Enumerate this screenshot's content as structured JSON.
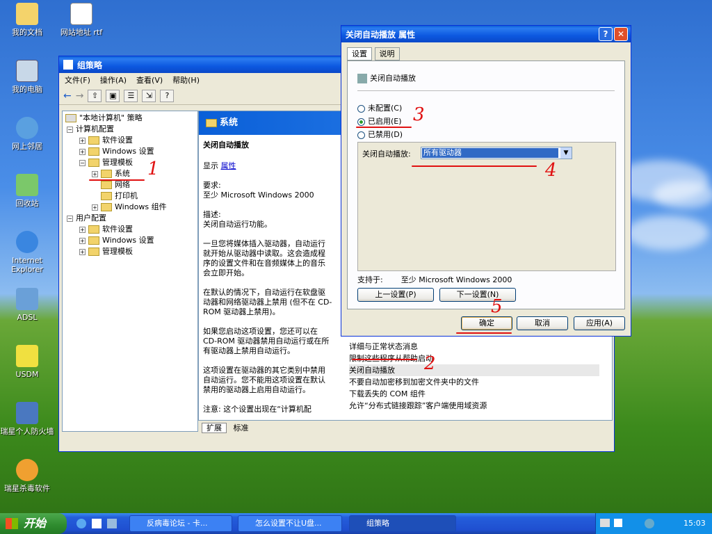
{
  "desktop": {
    "icons": [
      "我的文档",
      "网站地址 rtf",
      "我的电脑",
      "网上邻居",
      "回收站",
      "Internet Explorer",
      "ADSL",
      "USDM",
      "瑞星个人防火墙",
      "瑞星杀毒软件"
    ]
  },
  "gp": {
    "title": "组策略",
    "menus": [
      "文件(F)",
      "操作(A)",
      "查看(V)",
      "帮助(H)"
    ],
    "tree": [
      "\"本地计算机\" 策略",
      "计算机配置",
      "软件设置",
      "Windows 设置",
      "管理模板",
      "系统",
      "网络",
      "打印机",
      "Windows 组件",
      "用户配置",
      "软件设置",
      "Windows 设置",
      "管理模板"
    ],
    "header": "系统",
    "policy_title": "关闭自动播放",
    "show": "显示",
    "props_link": "属性",
    "req_label": "要求:",
    "req_value": "至少 Microsoft Windows 2000",
    "desc_label": "描述:",
    "desc_value": "关闭自动运行功能。",
    "para1": "一旦您将媒体插入驱动器，自动运行就开始从驱动器中读取。这会造成程序的设置文件和在音频媒体上的音乐会立即开始。",
    "para2": "在默认的情况下，自动运行在软盘驱动器和网络驱动器上禁用 (但不在 CD-ROM 驱动器上禁用)。",
    "para3": "如果您启动这项设置，您还可以在 CD-ROM 驱动器禁用自动运行或在所有驱动器上禁用自动运行。",
    "para4": "这项设置在驱动器的其它类别中禁用自动运行。您不能用这项设置在默认禁用的驱动器上启用自动运行。",
    "para5": "注意: 这个设置出现在“计算机配",
    "list": [
      "详细与正常状态消息",
      "限制这些程序从帮助启动",
      "关闭自动播放",
      "不要自动加密移到加密文件夹中的文件",
      "下载丢失的 COM 组件",
      "允许“分布式链接跟踪”客户端使用域资源"
    ],
    "tabs": [
      "扩展",
      "标准"
    ]
  },
  "dlg": {
    "title": "关闭自动播放 属性",
    "tabs": [
      "设置",
      "说明"
    ],
    "policy": "关闭自动播放",
    "radios": [
      "未配置(C)",
      "已启用(E)",
      "已禁用(D)"
    ],
    "selected": 1,
    "option_label": "关闭自动播放:",
    "option_value": "所有驱动器",
    "supported_label": "支持于:",
    "supported_value": "至少 Microsoft Windows 2000",
    "prev": "上一设置(P)",
    "next": "下一设置(N)",
    "ok": "确定",
    "cancel": "取消",
    "apply": "应用(A)"
  },
  "annotations": [
    "1",
    "2",
    "3",
    "4",
    "5"
  ],
  "taskbar": {
    "start": "开始",
    "tasks": [
      "反病毒论坛 - 卡...",
      "怎么设置不让U盘...",
      "组策略"
    ],
    "clock": "15:03"
  }
}
